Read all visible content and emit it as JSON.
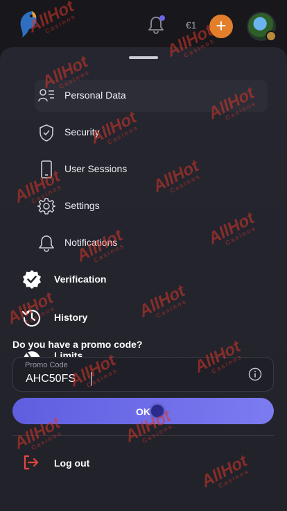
{
  "header": {
    "balance_text": "€1",
    "add_label": "+",
    "notifications_icon": "bell-icon",
    "logo_icon": "parrot-logo-icon"
  },
  "menu": {
    "sub_items": [
      {
        "label": "Personal Data",
        "icon": "id-card-icon"
      },
      {
        "label": "Security",
        "icon": "shield-check-icon"
      },
      {
        "label": "User Sessions",
        "icon": "phone-icon"
      },
      {
        "label": "Settings",
        "icon": "gear-icon"
      },
      {
        "label": "Notifications",
        "icon": "bell-icon"
      }
    ],
    "main_items": [
      {
        "label": "Verification",
        "icon": "verified-badge-icon"
      },
      {
        "label": "History",
        "icon": "history-clock-icon"
      },
      {
        "label": "Limits",
        "icon": "gauge-icon"
      }
    ]
  },
  "promo": {
    "question": "Do you have a promo code?",
    "field_label": "Promo Code",
    "field_value": "AHC50FS",
    "submit_label": "OK"
  },
  "logout": {
    "label": "Log out"
  },
  "watermark": {
    "text": "AllHot",
    "subtext": "Casinos"
  },
  "colors": {
    "background": "#17171c",
    "sheet": "#262630",
    "accent": "#6d6ce8",
    "add_button": "#e37f2b",
    "watermark": "#d73728"
  }
}
